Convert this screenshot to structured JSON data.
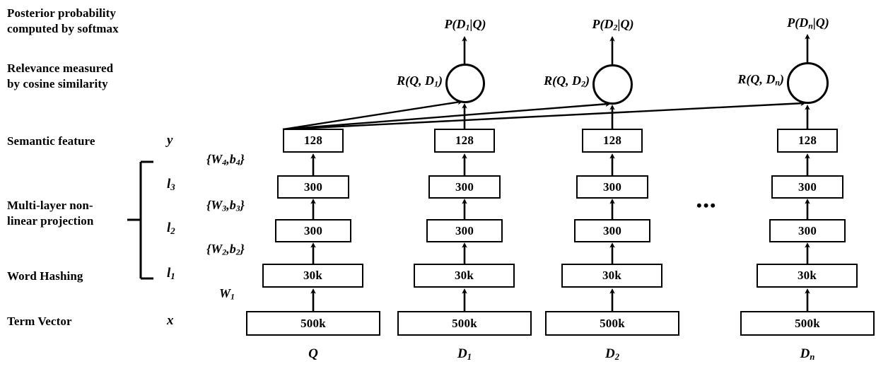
{
  "figure": {
    "title": "DSSM deep structured semantic model architecture",
    "stroke_color": "#000000",
    "background_color": "#ffffff"
  },
  "annotations": {
    "posterior": "Posterior probability\ncomputed by softmax",
    "relevance": "Relevance measured\nby cosine similarity",
    "semantic_feature": "Semantic feature",
    "multi_layer": "Multi-layer non-\nlinear projection",
    "word_hashing": "Word Hashing",
    "term_vector": "Term Vector"
  },
  "layer_symbols": {
    "y": "y",
    "l3": "l",
    "l3_sub": "3",
    "l2": "l",
    "l2_sub": "2",
    "l1": "l",
    "l1_sub": "1",
    "x": "x"
  },
  "weights": [
    {
      "id": "w4",
      "base": "{W",
      "sub1": "4",
      "mid": ",b",
      "sub2": "4",
      "close": "}"
    },
    {
      "id": "w3",
      "base": "{W",
      "sub1": "3",
      "mid": ",b",
      "sub2": "3",
      "close": "}"
    },
    {
      "id": "w2",
      "base": "{W",
      "sub1": "2",
      "mid": ",b",
      "sub2": "2",
      "close": "}"
    },
    {
      "id": "w1",
      "base": "W",
      "sub1": "1",
      "mid": "",
      "sub2": "",
      "close": ""
    }
  ],
  "weight_labels": {
    "w4_text": "{W4,b4}",
    "w3_text": "{W3,b3}",
    "w2_text": "{W2,b2}",
    "w1_text": "W1"
  },
  "columns": [
    {
      "id": "query",
      "bottom_label": "Q",
      "bottom_label_sub": "",
      "prob_label": "",
      "prob_label_sub": "",
      "relevance_label": "",
      "relevance_label_sub": "",
      "has_node": false,
      "boxes": [
        {
          "name": "semantic",
          "value": "128"
        },
        {
          "name": "hidden3",
          "value": "300"
        },
        {
          "name": "hidden2",
          "value": "300"
        },
        {
          "name": "wordhash",
          "value": "30k"
        },
        {
          "name": "termvector",
          "value": "500k"
        }
      ]
    },
    {
      "id": "doc1",
      "bottom_label": "D",
      "bottom_label_sub": "1",
      "prob_label": "P(D",
      "prob_label_sub": "1",
      "prob_label_tail": "|Q)",
      "relevance_label": "R(Q, D",
      "relevance_label_sub": "1",
      "relevance_label_tail": ")",
      "has_node": true,
      "boxes": [
        {
          "name": "semantic",
          "value": "128"
        },
        {
          "name": "hidden3",
          "value": "300"
        },
        {
          "name": "hidden2",
          "value": "300"
        },
        {
          "name": "wordhash",
          "value": "30k"
        },
        {
          "name": "termvector",
          "value": "500k"
        }
      ]
    },
    {
      "id": "doc2",
      "bottom_label": "D",
      "bottom_label_sub": "2",
      "prob_label": "P(D",
      "prob_label_sub": "2",
      "prob_label_tail": "|Q)",
      "relevance_label": "R(Q, D",
      "relevance_label_sub": "2",
      "relevance_label_tail": ")",
      "has_node": true,
      "boxes": [
        {
          "name": "semantic",
          "value": "128"
        },
        {
          "name": "hidden3",
          "value": "300"
        },
        {
          "name": "hidden2",
          "value": "300"
        },
        {
          "name": "wordhash",
          "value": "30k"
        },
        {
          "name": "termvector",
          "value": "500k"
        }
      ]
    },
    {
      "id": "docn",
      "bottom_label": "D",
      "bottom_label_sub": "n",
      "prob_label": "P(D",
      "prob_label_sub": "n",
      "prob_label_tail": "|Q)",
      "relevance_label": "R(Q, D",
      "relevance_label_sub": "n",
      "relevance_label_tail": ")",
      "has_node": true,
      "boxes": [
        {
          "name": "semantic",
          "value": "128"
        },
        {
          "name": "hidden3",
          "value": "300"
        },
        {
          "name": "hidden2",
          "value": "300"
        },
        {
          "name": "wordhash",
          "value": "30k"
        },
        {
          "name": "termvector",
          "value": "500k"
        }
      ]
    }
  ],
  "ellipsis": "•••"
}
